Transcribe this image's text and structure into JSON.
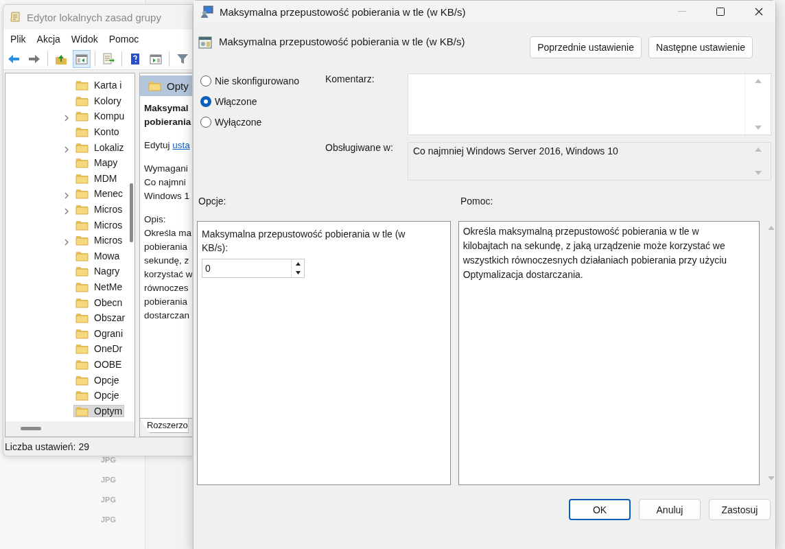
{
  "background_app": {
    "file_types": [
      "JPG",
      "JPG",
      "JPG",
      "JPG"
    ]
  },
  "editor_window": {
    "title": "Edytor lokalnych zasad grupy",
    "menu": [
      "Plik",
      "Akcja",
      "Widok",
      "Pomoc"
    ],
    "toolbar": [
      {
        "kind": "back",
        "pressed": false
      },
      {
        "kind": "forward",
        "pressed": false
      },
      {
        "kind": "up",
        "pressed": false
      },
      {
        "kind": "tree",
        "pressed": true
      },
      {
        "kind": "export",
        "pressed": false
      },
      {
        "kind": "help",
        "pressed": false
      },
      {
        "kind": "view",
        "pressed": false
      },
      {
        "kind": "filter",
        "pressed": false
      }
    ],
    "tree": [
      {
        "label": "Karta i",
        "expandable": false,
        "selected": false
      },
      {
        "label": "Kolory",
        "expandable": false,
        "selected": false
      },
      {
        "label": "Kompu",
        "expandable": true,
        "selected": false
      },
      {
        "label": "Konto",
        "expandable": false,
        "selected": false
      },
      {
        "label": "Lokaliz",
        "expandable": true,
        "selected": false
      },
      {
        "label": "Mapy",
        "expandable": false,
        "selected": false
      },
      {
        "label": "MDM",
        "expandable": false,
        "selected": false
      },
      {
        "label": "Menec",
        "expandable": true,
        "selected": false
      },
      {
        "label": "Micros",
        "expandable": true,
        "selected": false
      },
      {
        "label": "Micros",
        "expandable": false,
        "selected": false
      },
      {
        "label": "Micros",
        "expandable": true,
        "selected": false
      },
      {
        "label": "Mowa",
        "expandable": false,
        "selected": false
      },
      {
        "label": "Nagry",
        "expandable": false,
        "selected": false
      },
      {
        "label": "NetMe",
        "expandable": false,
        "selected": false
      },
      {
        "label": "Obecn",
        "expandable": false,
        "selected": false
      },
      {
        "label": "Obszar",
        "expandable": false,
        "selected": false
      },
      {
        "label": "Ograni",
        "expandable": false,
        "selected": false
      },
      {
        "label": "OneDr",
        "expandable": false,
        "selected": false
      },
      {
        "label": "OOBE",
        "expandable": false,
        "selected": false
      },
      {
        "label": "Opcje",
        "expandable": false,
        "selected": false
      },
      {
        "label": "Opcje",
        "expandable": false,
        "selected": false
      },
      {
        "label": "Optym",
        "expandable": false,
        "selected": true
      }
    ],
    "details": {
      "header": "Opty",
      "title_lines": [
        "Maksymal",
        "pobierania"
      ],
      "edit_text": "Edytuj",
      "edit_link": "usta",
      "requirements_lines": [
        "Wymagani",
        "Co najmni",
        "Windows 1"
      ],
      "description_label": "Opis:",
      "description_lines": [
        "Określa ma",
        "pobierania",
        "sekundę, z",
        "korzystać w",
        "równoczes",
        "pobierania",
        "dostarczan"
      ],
      "tab": "Rozszerzo"
    },
    "status_bar": "Liczba ustawień: 29"
  },
  "dialog": {
    "title": "Maksymalna przepustowość pobierania w tle (w KB/s)",
    "heading": "Maksymalna przepustowość pobierania w tle (w KB/s)",
    "nav_buttons": [
      "Poprzednie ustawienie",
      "Następne ustawienie"
    ],
    "radios": [
      {
        "label": "Nie skonfigurowano",
        "selected": false
      },
      {
        "label": "Włączone",
        "selected": true
      },
      {
        "label": "Wyłączone",
        "selected": false
      }
    ],
    "comment_label": "Komentarz:",
    "supported_label": "Obsługiwane w:",
    "supported_text": "Co najmniej Windows Server 2016, Windows 10",
    "options_label": "Opcje:",
    "help_label": "Pomoc:",
    "option": {
      "label": "Maksymalna przepustowość pobierania w tle (w KB/s):",
      "value": "0"
    },
    "help_text": "Określa maksymalną przepustowość pobierania w tle w kilobajtach na sekundę, z jaką urządzenie może korzystać we wszystkich równoczesnych działaniach pobierania przy użyciu Optymalizacja dostarczania.",
    "buttons": [
      {
        "label": "OK",
        "default": true
      },
      {
        "label": "Anuluj",
        "default": false
      },
      {
        "label": "Zastosuj",
        "default": false
      }
    ]
  }
}
